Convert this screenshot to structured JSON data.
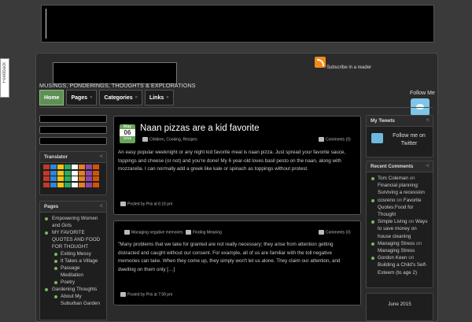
{
  "site": {
    "tagline": "MUSINGS, PONDERINGS, THOUGHTS & EXPLORATIONS",
    "subscribe": "Subscribe in a reader",
    "follow_me": "Follow Me",
    "side_tab": "Feedback",
    "side_tab_close": "×"
  },
  "nav": {
    "tabs": [
      {
        "label": "Home"
      },
      {
        "label": "Pages"
      },
      {
        "label": "Categories"
      },
      {
        "label": "Links"
      }
    ],
    "more_mark": "»"
  },
  "left_sidebar": {
    "translator_title": "Translator",
    "pages_title": "Pages",
    "pages": [
      {
        "label": "Empowering Women and Girls",
        "level": 0
      },
      {
        "label": "MY FAVORITE QUOTES AND FOOD FOR THOUGHT",
        "level": 0
      },
      {
        "label": "Exiting Messy",
        "level": 1
      },
      {
        "label": "It Takes a Village",
        "level": 1
      },
      {
        "label": "Passage Meditation",
        "level": 1
      },
      {
        "label": "Poetry",
        "level": 1
      },
      {
        "label": "Gardening Thoughts",
        "level": 0
      },
      {
        "label": "About My Suburban Garden",
        "level": 1
      }
    ]
  },
  "posts": [
    {
      "month": "May",
      "day": "06",
      "year": "2015",
      "title": "Naan pizzas are a kid favorite",
      "categories": "Children, Cooking, Recipes",
      "comments": "Comments (0)",
      "body": "An easy popular weeknight or any night kid favorite meal is naan pizza. Just spread your favorite sauce, toppings and cheese (or not) and you're done! My 6 year-old loves basil pesto on the naan, along with mozzarella. I can normally add a greek like kale or spinach as toppings without protest.",
      "posted": "Posted by Pris at 6:16 pm"
    },
    {
      "tag1": "Managing negative memories",
      "tag2": "Finding Meaning",
      "comments": "Comments (0)",
      "body": "\"Many problems that we take for granted are not really necessary; they arise from attention getting distracted and caught without our consent. For example, all of us are familiar with the toll negative memories can take. When they come up, they simply won't let us alone. They claim our attention, and dwelling on them only […]",
      "posted": "Posted by Pris at 7:59 pm"
    }
  ],
  "right_sidebar": {
    "tweets_title": "My Tweets",
    "tweets_follow": "Follow me on Twitter",
    "recent_title": "Recent Comments",
    "recent": [
      {
        "who": "Tom Coleman",
        "on": "on",
        "what": "Financial planning: Surviving a recession"
      },
      {
        "who": "cosreno",
        "on": "on",
        "what": "Favorite Quotes:Food for Thought"
      },
      {
        "who": "Simple Living",
        "on": "on",
        "what": "Ways to save money on house cleaning"
      },
      {
        "who": "Managing Stress",
        "on": "on",
        "what": "Managing Stress"
      },
      {
        "who": "Gordon Keen",
        "on": "on",
        "what": "Building a Child's Self-Esteem (to age 2)"
      }
    ],
    "calendar_title": "June 2015"
  },
  "colors": {
    "accent_green": "#6aa45a",
    "rss_orange": "#f28a1a",
    "twitter_blue": "#7fc5e8"
  }
}
